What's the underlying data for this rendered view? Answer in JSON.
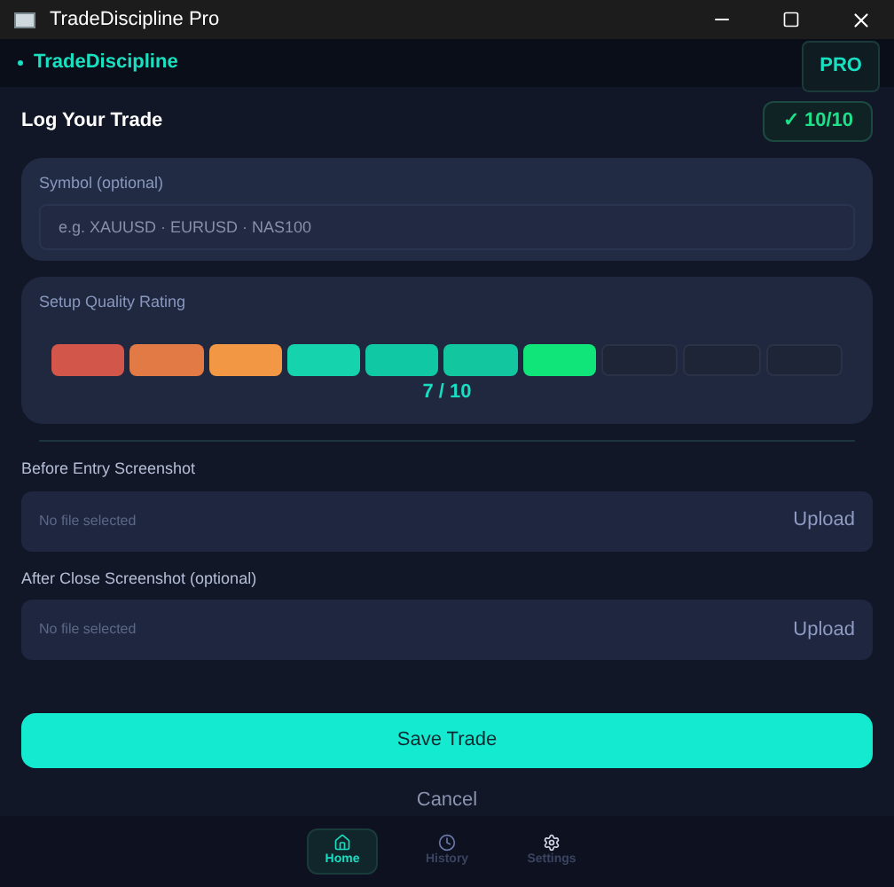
{
  "window": {
    "title": "TradeDiscipline Pro"
  },
  "header": {
    "brand": "TradeDiscipline",
    "badge": "PRO"
  },
  "form": {
    "title": "Log Your Trade",
    "progress": "✓ 10/10",
    "symbol": {
      "label": "Symbol  (optional)",
      "placeholder": "e.g. XAUUSD · EURUSD · NAS100"
    },
    "rating": {
      "label": "Setup Quality Rating",
      "score": "7 / 10",
      "segments": [
        {
          "filled": true,
          "color": "#d2574a"
        },
        {
          "filled": true,
          "color": "#e27a45"
        },
        {
          "filled": true,
          "color": "#f29844"
        },
        {
          "filled": true,
          "color": "#14d3ad"
        },
        {
          "filled": true,
          "color": "#10c9a4"
        },
        {
          "filled": true,
          "color": "#12c6a0"
        },
        {
          "filled": true,
          "color": "#10e57a"
        },
        {
          "filled": false,
          "color": "#1e2536"
        },
        {
          "filled": false,
          "color": "#1e2536"
        },
        {
          "filled": false,
          "color": "#1e2536"
        }
      ]
    },
    "uploads": [
      {
        "label": "Before Entry Screenshot",
        "status": "No file selected",
        "button": "Upload"
      },
      {
        "label": "After Close Screenshot  (optional)",
        "status": "No file selected",
        "button": "Upload"
      }
    ],
    "save": "Save Trade",
    "cancel": "Cancel"
  },
  "nav": [
    {
      "kind": "home",
      "label": "Home",
      "selected": true
    },
    {
      "kind": "history",
      "label": "History",
      "selected": false
    },
    {
      "kind": "settings",
      "label": "Settings",
      "selected": false
    }
  ]
}
